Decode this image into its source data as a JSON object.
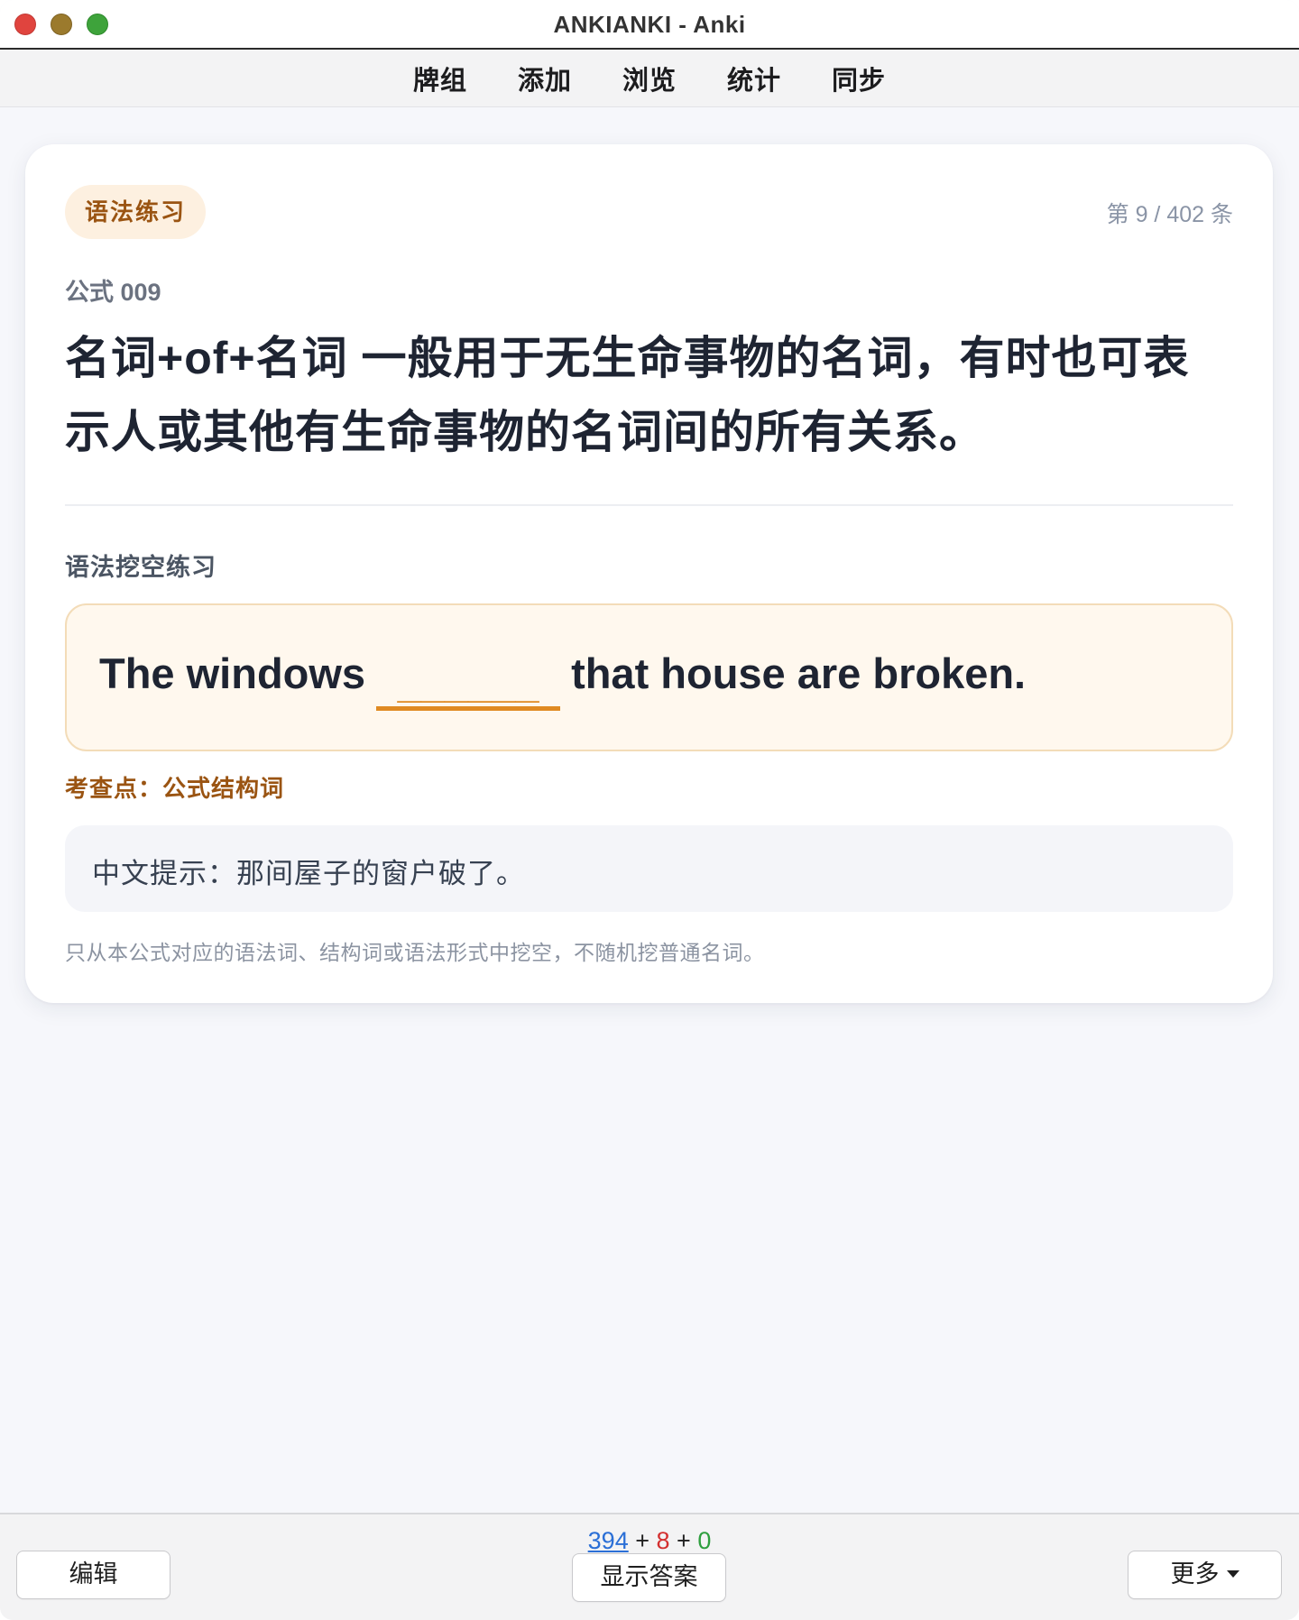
{
  "window": {
    "title": "ANKIANKI - Anki"
  },
  "nav": {
    "items": [
      "牌组",
      "添加",
      "浏览",
      "统计",
      "同步"
    ]
  },
  "card": {
    "tag": "语法练习",
    "counter": "第 9 / 402 条",
    "formula_id": "公式 009",
    "formula_title_line1": "名词+of+名词 一般用于无生命事物的名词，有时也可表",
    "formula_title_line2": "示人或其他有生命事物的名词间的所有关系。",
    "section_label": "语法挖空练习",
    "cloze": {
      "before": "The windows",
      "blank": "______",
      "after": "that house are broken."
    },
    "test_point": "考查点：公式结构词",
    "hint": "中文提示：那间屋子的窗户破了。",
    "note": "只从本公式对应的语法词、结构词或语法形式中挖空，不随机挖普通名词。"
  },
  "bottom": {
    "count_new": "394",
    "plus1": " + ",
    "count_learn": "8",
    "plus2": " + ",
    "count_review": "0",
    "edit_label": "编辑",
    "show_answer_label": "显示答案",
    "more_label": "更多"
  },
  "colors": {
    "accent_orange": "#e08a22",
    "tag_text": "#9a5412",
    "new_blue": "#2b6fd6",
    "learn_red": "#d32f2f",
    "review_green": "#2e9e3e"
  },
  "icons": {
    "close": "close-icon",
    "minimize": "minimize-icon",
    "maximize": "maximize-icon",
    "more_dropdown": "chevron-down-icon"
  }
}
